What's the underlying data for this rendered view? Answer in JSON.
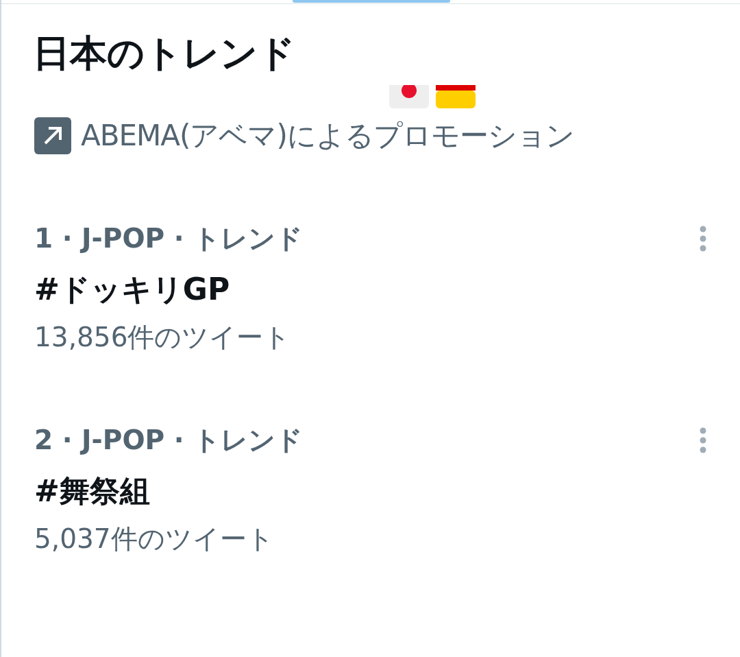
{
  "header": {
    "title": "日本のトレンド"
  },
  "promoted": {
    "label": "ABEMA(アベマ)によるプロモーション"
  },
  "trends": [
    {
      "meta": "1 · J-POP · トレンド",
      "name": "#ドッキリGP",
      "count": "13,856件のツイート"
    },
    {
      "meta": "2 · J-POP · トレンド",
      "name": "#舞祭組",
      "count": "5,037件のツイート"
    }
  ]
}
